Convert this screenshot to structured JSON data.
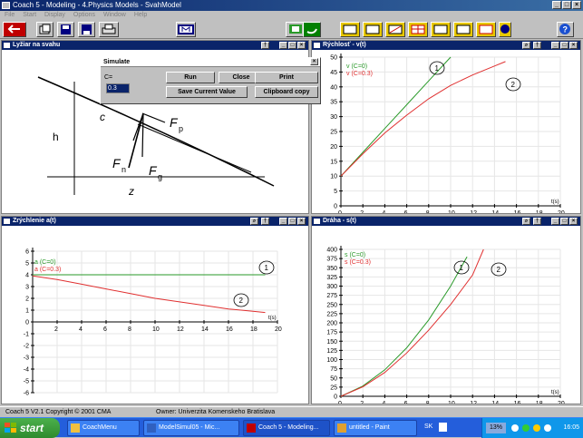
{
  "app": {
    "title": "Coach 5 - Modeling - 4.Physics Models - SvahModel"
  },
  "menu": [
    "File",
    "Start",
    "Display",
    "Options",
    "Window",
    "Help"
  ],
  "panels": {
    "slope": {
      "title": "Lyžiar na svahu",
      "labels": {
        "h": "h",
        "c": "c",
        "fp": "F",
        "fp_sub": "p",
        "fn": "F",
        "fn_sub": "n",
        "fg": "F",
        "fg_sub": "g",
        "z": "z"
      }
    },
    "velocity": {
      "title": "Rýchlosť - v(t)"
    },
    "accel": {
      "title": "Zrýchlenie a(t)"
    },
    "distance": {
      "title": "Dráha - s(t)"
    }
  },
  "dialog": {
    "title": "Simulate",
    "c_label": "C=",
    "c_value": "0.3",
    "run": "Run",
    "close": "Close",
    "print": "Print",
    "save": "Save Current Value",
    "clipboard": "Clipboard copy"
  },
  "status": {
    "left": "Coach 5 V2.1 Copyright © 2001 CMA",
    "right": "Owner: Univerzita Komenskeho Bratislava"
  },
  "taskbar": {
    "start": "start",
    "tasks": [
      "CoachMenu",
      "ModelSimul05 - Mic...",
      "Coach 5 - Modeling...",
      "untitled - Paint"
    ],
    "lang": "SK",
    "zoom": "13%",
    "time": "16:05"
  },
  "colors": {
    "series1": "#2a9a2a",
    "series2": "#e03030"
  },
  "chart_data": [
    {
      "type": "line",
      "title": "Rýchlosť - v(t)",
      "xlabel": "t(s)",
      "xlim": [
        0,
        20
      ],
      "ylim": [
        0,
        50
      ],
      "xticks": [
        0,
        2,
        4,
        6,
        8,
        10,
        12,
        14,
        16,
        18,
        20
      ],
      "yticks": [
        0,
        5,
        10,
        15,
        20,
        25,
        30,
        35,
        40,
        45,
        50
      ],
      "legend": [
        "v (C=0)",
        "v (C=0.3)"
      ],
      "annotations": [
        "1",
        "2"
      ],
      "series": [
        {
          "name": "v (C=0)",
          "x": [
            0,
            2,
            4,
            6,
            8,
            10
          ],
          "y": [
            10,
            18,
            26,
            34,
            42,
            50
          ]
        },
        {
          "name": "v (C=0.3)",
          "x": [
            0,
            2,
            4,
            6,
            8,
            10,
            12,
            14,
            15
          ],
          "y": [
            10,
            17.5,
            24.5,
            30.5,
            36,
            40.5,
            44,
            47,
            48.5
          ]
        }
      ]
    },
    {
      "type": "line",
      "title": "Zrýchlenie a(t)",
      "xlabel": "t(s)",
      "xlim": [
        0,
        20
      ],
      "ylim": [
        -6,
        6
      ],
      "xticks": [
        2,
        4,
        6,
        8,
        10,
        12,
        14,
        16,
        18,
        20
      ],
      "yticks": [
        -6,
        -5,
        -4,
        -3,
        -2,
        -1,
        0,
        1,
        2,
        3,
        4,
        5,
        6
      ],
      "legend": [
        "a (C=0)",
        "a (C=0.3)"
      ],
      "annotations": [
        "1",
        "2"
      ],
      "series": [
        {
          "name": "a (C=0)",
          "x": [
            0,
            19
          ],
          "y": [
            4,
            4
          ]
        },
        {
          "name": "a (C=0.3)",
          "x": [
            0,
            2,
            4,
            6,
            8,
            10,
            12,
            14,
            16,
            18,
            19
          ],
          "y": [
            3.9,
            3.6,
            3.2,
            2.8,
            2.4,
            2.0,
            1.7,
            1.4,
            1.1,
            0.9,
            0.8
          ]
        }
      ]
    },
    {
      "type": "line",
      "title": "Dráha - s(t)",
      "xlabel": "t(s)",
      "xlim": [
        0,
        20
      ],
      "ylim": [
        0,
        400
      ],
      "xticks": [
        0,
        2,
        4,
        6,
        8,
        10,
        12,
        14,
        16,
        18,
        20
      ],
      "yticks": [
        0,
        25,
        50,
        75,
        100,
        125,
        150,
        175,
        200,
        225,
        250,
        275,
        300,
        325,
        350,
        375,
        400
      ],
      "legend": [
        "s (C=0)",
        "s (C=0.3)"
      ],
      "annotations": [
        "1",
        "2"
      ],
      "series": [
        {
          "name": "s (C=0)",
          "x": [
            0,
            2,
            4,
            6,
            8,
            10,
            11.5
          ],
          "y": [
            0,
            28,
            72,
            132,
            208,
            300,
            380
          ]
        },
        {
          "name": "s (C=0.3)",
          "x": [
            0,
            2,
            4,
            6,
            8,
            10,
            12,
            13
          ],
          "y": [
            0,
            26,
            65,
            118,
            180,
            250,
            330,
            400
          ]
        }
      ]
    }
  ]
}
